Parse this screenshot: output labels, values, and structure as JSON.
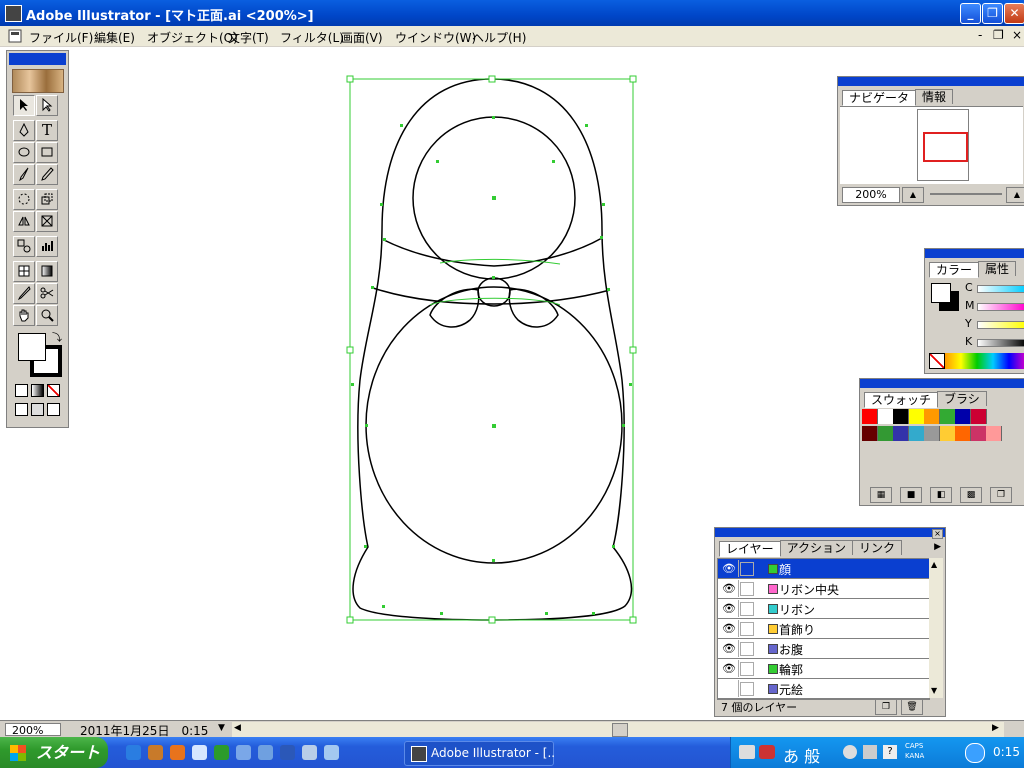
{
  "window": {
    "title": "Adobe Illustrator - [マト正面.ai <200%>]",
    "controls": {
      "minimize": "_",
      "restore": "❐",
      "close": "✕"
    }
  },
  "menu": {
    "items": [
      "ファイル(F)",
      "編集(E)",
      "オブジェクト(O)",
      "文字(T)",
      "フィルタ(L)",
      "画面(V)",
      "ウインドウ(W)",
      "ヘルプ(H)"
    ],
    "doc_controls": {
      "minimize": "-",
      "restore": "❐",
      "close": "×"
    }
  },
  "toolbox": {
    "tools": [
      "selection-tool",
      "direct-selection-tool",
      "pen-tool",
      "type-tool",
      "ellipse-tool",
      "rectangle-tool",
      "paintbrush-tool",
      "pencil-tool",
      "rotate-tool",
      "scale-tool",
      "reflect-tool",
      "free-transform-tool",
      "symbol-sprayer-tool",
      "graph-tool",
      "mesh-tool",
      "gradient-tool",
      "eyedropper-tool",
      "scissors-tool",
      "hand-tool",
      "zoom-tool"
    ],
    "type_tool_glyph": "T"
  },
  "navigator": {
    "tabs": [
      "ナビゲータ",
      "情報"
    ],
    "zoom": "200%"
  },
  "color_panel": {
    "tabs": [
      "カラー",
      "属性"
    ],
    "channels": [
      "C",
      "M",
      "Y",
      "K"
    ]
  },
  "swatches_panel": {
    "tabs": [
      "スウォッチ",
      "ブラシ"
    ],
    "row1": [
      "#ff0000",
      "#ffffff",
      "#000000",
      "#ffff00",
      "#ff9900",
      "#33aa33",
      "#0000aa",
      "#cc0033"
    ],
    "row2": [
      "#660000",
      "#339933",
      "#3333aa",
      "#33aacc",
      "#999999",
      "#ffcc33",
      "#ff6600",
      "#cc3366",
      "#ff9999"
    ]
  },
  "layers_panel": {
    "tabs": [
      "レイヤー",
      "アクション",
      "リンク"
    ],
    "layers": [
      {
        "name": "顔",
        "color": "#33cc33",
        "visible": true,
        "selected": true
      },
      {
        "name": "リボン中央",
        "color": "#ff66cc",
        "visible": true,
        "selected": false
      },
      {
        "name": "リボン",
        "color": "#33cccc",
        "visible": true,
        "selected": false
      },
      {
        "name": "首飾り",
        "color": "#ffcc33",
        "visible": true,
        "selected": false
      },
      {
        "name": "お腹",
        "color": "#6666cc",
        "visible": true,
        "selected": false
      },
      {
        "name": "輪郭",
        "color": "#33cc33",
        "visible": true,
        "selected": false
      },
      {
        "name": "元絵",
        "color": "#6666cc",
        "visible": false,
        "selected": false
      }
    ],
    "count_label": "7 個のレイヤー"
  },
  "statusbar": {
    "zoom": "200%",
    "info": "2011年1月25日　0:15"
  },
  "taskbar": {
    "start_label": "スタート",
    "task_item": "Adobe Illustrator - [..",
    "ime": "あ 般",
    "caps": "CAPS",
    "kana": "KANA",
    "clock": "0:15"
  },
  "colors": {
    "selection_green": "#33cc33",
    "title_blue": "#0a3fd0"
  }
}
